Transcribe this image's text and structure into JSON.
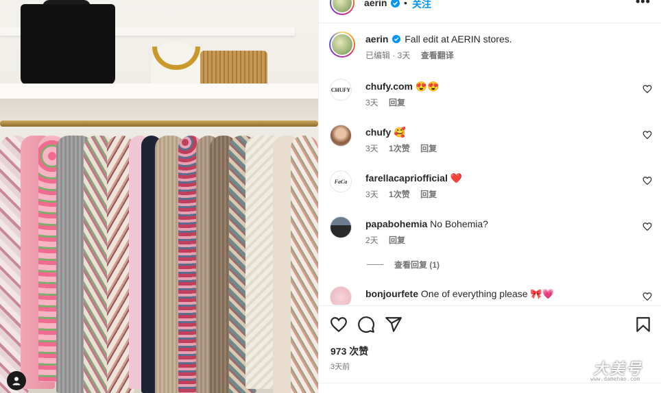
{
  "post": {
    "author": "aerin",
    "follow_label": "关注",
    "separator": "•",
    "more_label": "•••"
  },
  "caption": {
    "user": "aerin",
    "text": "Fall edit at AERIN stores.",
    "edited": "已编辑 · 3天",
    "translate": "查看翻译"
  },
  "comments": [
    {
      "user": "chufy.com",
      "text": "😍😍",
      "time": "3天",
      "likes": "",
      "reply": "回复",
      "avatar_text": "CHUFY"
    },
    {
      "user": "chufy",
      "text": "🥰",
      "time": "3天",
      "likes": "1次赞",
      "reply": "回复",
      "avatar_text": ""
    },
    {
      "user": "farellacapriofficial",
      "text": "❤️",
      "time": "3天",
      "likes": "1次赞",
      "reply": "回复",
      "avatar_text": "FaCa"
    },
    {
      "user": "papabohemia",
      "text": "No Bohemia?",
      "time": "2天",
      "likes": "",
      "reply": "回复",
      "avatar_text": ""
    },
    {
      "user": "bonjourfete",
      "text": "One of everything please 🎀💗",
      "time": "",
      "likes": "",
      "reply": "",
      "avatar_text": ""
    }
  ],
  "view_replies": "查看回复 (1)",
  "actions": {
    "likes": "973 次赞",
    "ago": "3天前",
    "icons": [
      "heart-icon",
      "comment-icon",
      "share-icon",
      "bookmark-icon"
    ]
  },
  "watermark": {
    "main": "大美号",
    "sub": "www.damehao.com"
  },
  "colors": {
    "accent": "#0095f6",
    "text": "#262626",
    "muted": "#737373",
    "verified": "#0095f6"
  }
}
